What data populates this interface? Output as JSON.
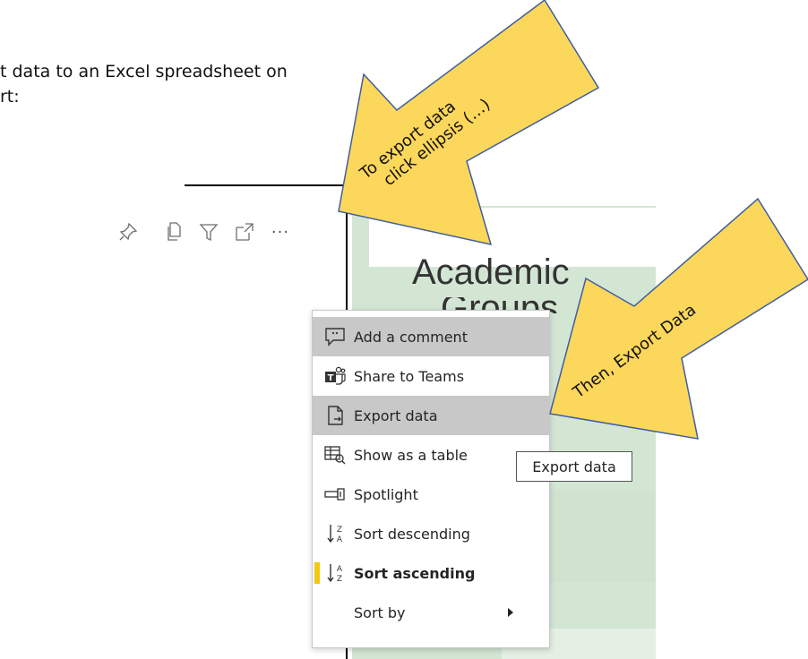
{
  "intro": {
    "line1": "t data to an Excel spreadsheet on",
    "line2": "rt:"
  },
  "visual_header": {
    "icons": [
      "pin-icon",
      "copy-icon",
      "filter-icon",
      "focus-mode-icon",
      "more-options-icon"
    ],
    "more_options_label": "···"
  },
  "report": {
    "title_fragment": "Academic",
    "second_line_fragment": "Groups"
  },
  "context_menu": {
    "items": [
      {
        "label": "Add a comment",
        "icon": "comment-icon"
      },
      {
        "label": "Share to Teams",
        "icon": "teams-icon"
      },
      {
        "label": "Export data",
        "icon": "export-icon"
      },
      {
        "label": "Show as a table",
        "icon": "table-icon"
      },
      {
        "label": "Spotlight",
        "icon": "spotlight-icon"
      },
      {
        "label": "Sort descending",
        "icon": "sort-descending-icon"
      },
      {
        "label": "Sort ascending",
        "icon": "sort-ascending-icon",
        "selected": true
      },
      {
        "label": "Sort by",
        "icon": "",
        "submenu": true
      }
    ]
  },
  "tooltip": {
    "text": "Export data"
  },
  "callouts": {
    "first": {
      "line1": "To export data",
      "line2": "click ellipsis (…)"
    },
    "second": {
      "text": "Then, Export Data"
    },
    "fill_color": "#fbd75b",
    "stroke_color": "#3f5f9e"
  }
}
